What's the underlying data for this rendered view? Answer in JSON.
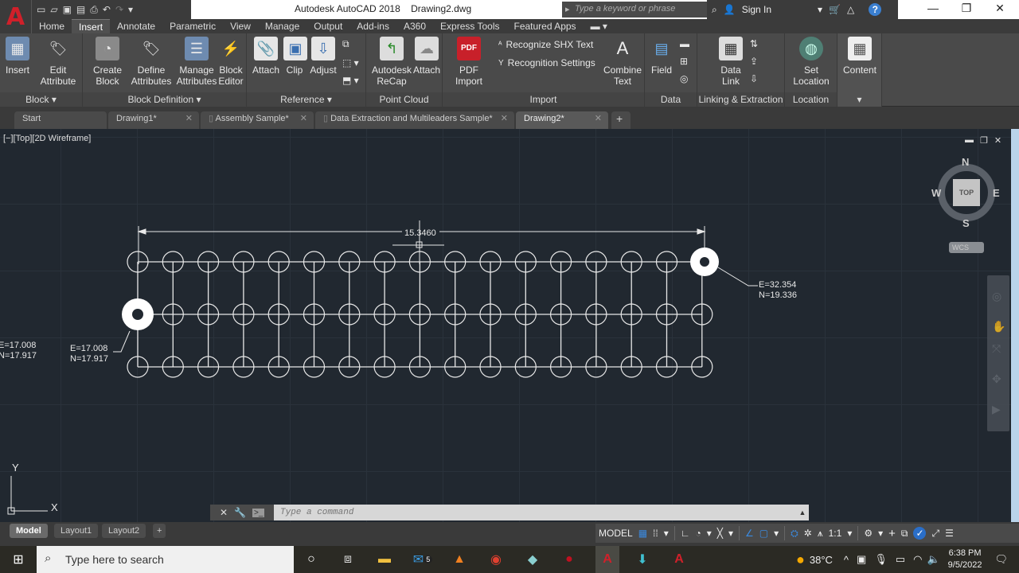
{
  "titlebar": {
    "app_name": "Autodesk AutoCAD 2018",
    "file_name": "Drawing2.dwg",
    "search_placeholder": "Type a keyword or phrase",
    "sign_in": "Sign In",
    "qat_icons": [
      "new-icon",
      "open-icon",
      "save-icon",
      "save-as-icon",
      "plot-icon",
      "undo-icon",
      "redo-icon",
      "customize-icon"
    ]
  },
  "ribbon_tabs": [
    "Home",
    "Insert",
    "Annotate",
    "Parametric",
    "View",
    "Manage",
    "Output",
    "Add-ins",
    "A360",
    "Express Tools",
    "Featured Apps"
  ],
  "active_ribbon_tab": "Insert",
  "ribbon": {
    "block": {
      "title": "Block",
      "tools": [
        "Insert",
        "Edit\nAttribute"
      ]
    },
    "block_definition": {
      "title": "Block Definition",
      "tools": [
        "Create\nBlock",
        "Define\nAttributes",
        "Manage\nAttributes",
        "Block\nEditor"
      ]
    },
    "reference": {
      "title": "Reference",
      "tools": [
        "Attach",
        "Clip",
        "Adjust"
      ]
    },
    "point_cloud": {
      "title": "Point Cloud",
      "tools": [
        "Autodesk\nReCap",
        "Attach"
      ]
    },
    "import": {
      "title": "Import",
      "pdf_import": "PDF\nImport",
      "recognize_shx": "Recognize SHX Text",
      "recognition_settings": "Recognition Settings",
      "combine_text": "Combine\nText"
    },
    "data": {
      "title": "Data",
      "field": "Field"
    },
    "linking": {
      "title": "Linking & Extraction",
      "data_link": "Data\nLink"
    },
    "location": {
      "title": "Location",
      "set_location": "Set\nLocation"
    },
    "content": {
      "title": "",
      "label": "Content"
    }
  },
  "file_tabs": [
    {
      "label": "Start",
      "closable": false,
      "active": false
    },
    {
      "label": "Drawing1*",
      "closable": true,
      "active": false
    },
    {
      "label": "Assembly Sample*",
      "closable": true,
      "active": false
    },
    {
      "label": "Data Extraction and Multileaders Sample*",
      "closable": true,
      "active": false
    },
    {
      "label": "Drawing2*",
      "closable": true,
      "active": true
    }
  ],
  "viewport": {
    "label": "[−][Top][2D Wireframe]",
    "dimension": "15.3460",
    "callout_top_right": {
      "e": "E=32.354",
      "n": "N=19.336"
    },
    "callout_left": {
      "e": "E=17.008",
      "n": "N=17.917"
    },
    "callout_left_clipped": {
      "e": "E=17.008",
      "n": "N=17.917"
    },
    "grid": {
      "columns": 17,
      "rows": 3
    },
    "viewcube": {
      "n": "N",
      "s": "S",
      "e": "E",
      "w": "W",
      "face": "TOP",
      "wcs": "WCS"
    },
    "ucs": {
      "x": "X",
      "y": "Y"
    }
  },
  "command": {
    "placeholder": "Type a command"
  },
  "layout_tabs": [
    "Model",
    "Layout1",
    "Layout2"
  ],
  "active_layout": "Model",
  "statusbar": {
    "model": "MODEL",
    "scale": "1:1"
  },
  "taskbar": {
    "search_placeholder": "Type here to search",
    "mail_badge": "5",
    "weather": "38°C",
    "time": "6:38 PM",
    "date": "9/5/2022"
  }
}
